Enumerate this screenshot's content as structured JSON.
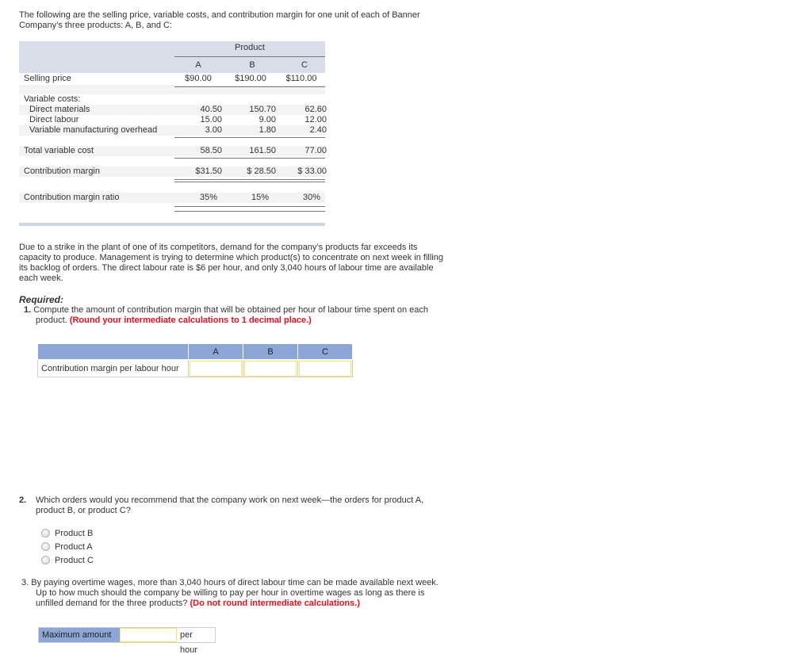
{
  "intro": "The following are the selling price, variable costs, and contribution margin for one unit of each of Banner Company’s three products: A, B, and C:",
  "data_table": {
    "group_header": "Product",
    "columns": [
      "A",
      "B",
      "C"
    ],
    "selling_price": {
      "label": "Selling price",
      "values": [
        "$90.00",
        "$190.00",
        "$110.00"
      ]
    },
    "variable_costs_label": "Variable costs:",
    "direct_materials": {
      "label": "Direct materials",
      "values": [
        "40.50",
        "150.70",
        "62.60"
      ]
    },
    "direct_labour": {
      "label": "Direct labour",
      "values": [
        "15.00",
        "9.00",
        "12.00"
      ]
    },
    "overhead": {
      "label": "Variable manufacturing overhead",
      "values": [
        "3.00",
        "1.80",
        "2.40"
      ]
    },
    "total_variable": {
      "label": "Total variable cost",
      "values": [
        "58.50",
        "161.50",
        "77.00"
      ]
    },
    "contribution_margin": {
      "label": "Contribution margin",
      "values": [
        "$31.50",
        "$ 28.50",
        "$ 33.00"
      ]
    },
    "cm_ratio": {
      "label": "Contribution margin ratio",
      "values": [
        "35%",
        "15%",
        "30%"
      ]
    }
  },
  "scenario": "Due to a strike in the plant of one of its competitors, demand for the company’s products far exceeds its capacity to produce. Management is trying to determine which product(s) to concentrate on next week in filling its backlog of orders. The direct labour rate is $6 per hour, and only 3,040 hours of labour time are available each week.",
  "required_label": "Required:",
  "q1": {
    "number": "1.",
    "text": "Compute the amount of contribution margin that will be obtained per hour of labour time spent on each product.",
    "note": "(Round your intermediate calculations to 1 decimal place.)",
    "table": {
      "columns": [
        "A",
        "B",
        "C"
      ],
      "row_label": "Contribution margin per labour hour",
      "values": [
        "",
        "",
        ""
      ]
    }
  },
  "q2": {
    "number": "2.",
    "text": "Which orders would you recommend that the company work on next week—the orders for product A, product B, or product C?",
    "options": [
      "Product B",
      "Product A",
      "Product C"
    ]
  },
  "q3": {
    "number": "3.",
    "text": "By paying overtime wages, more than 3,040 hours of direct labour time can be made available next week. Up to how much should the company be willing to pay per hour in overtime wages as long as there is unfilled demand for the three products?",
    "note": "(Do not round intermediate calculations.)",
    "input_label": "Maximum amount",
    "input_value": "",
    "suffix": "per hour"
  }
}
